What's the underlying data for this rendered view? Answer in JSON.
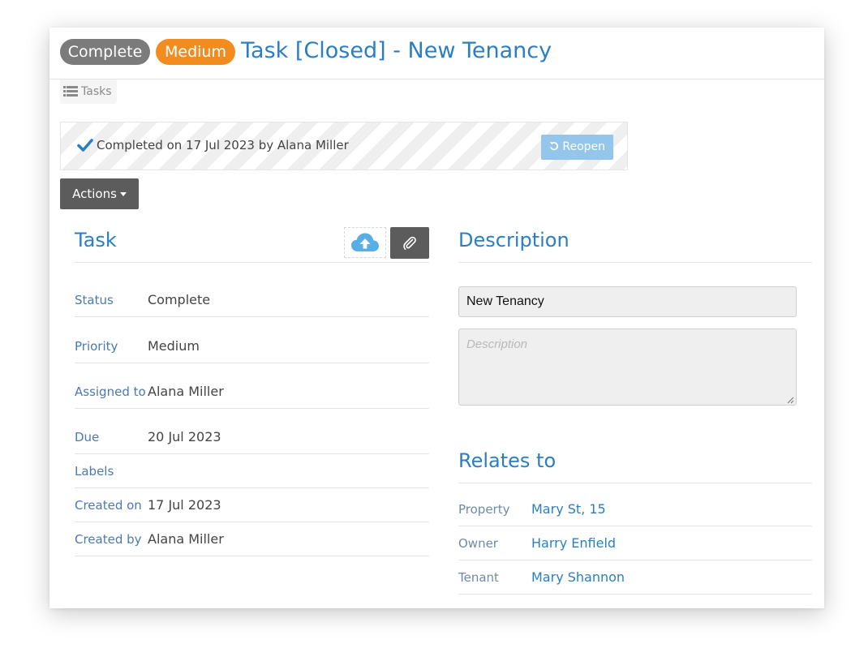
{
  "header": {
    "status_badge": "Complete",
    "priority_badge": "Medium",
    "title": "Task [Closed] - New Tenancy",
    "colors": {
      "status": "#7b7b7b",
      "priority": "#f28c1e",
      "accent": "#2a7fc4"
    }
  },
  "breadcrumb": {
    "tasks_label": "Tasks",
    "icon": "list-icon"
  },
  "completion": {
    "text": "Completed on 17 Jul 2023 by Alana Miller",
    "icon": "check-icon",
    "reopen_label": "Reopen",
    "reopen_icon": "undo-icon"
  },
  "actions": {
    "label": "Actions"
  },
  "task_panel": {
    "title": "Task",
    "upload_icon": "cloud-upload-icon",
    "attach_icon": "paperclip-icon",
    "fields": [
      {
        "label": "Status",
        "value": "Complete"
      },
      {
        "label": "Priority",
        "value": "Medium"
      },
      {
        "label": "Assigned to",
        "value": "Alana Miller"
      },
      {
        "label": "Due",
        "value": "20 Jul 2023"
      },
      {
        "label": "Labels",
        "value": ""
      },
      {
        "label": "Created on",
        "value": "17 Jul 2023"
      },
      {
        "label": "Created by",
        "value": "Alana Miller"
      }
    ]
  },
  "description_panel": {
    "title": "Description",
    "name_value": "New Tenancy",
    "description_value": "",
    "description_placeholder": "Description"
  },
  "relates_panel": {
    "title": "Relates to",
    "items": [
      {
        "label": "Property",
        "value": "Mary St, 15"
      },
      {
        "label": "Owner",
        "value": "Harry Enfield"
      },
      {
        "label": "Tenant",
        "value": "Mary Shannon"
      }
    ]
  }
}
